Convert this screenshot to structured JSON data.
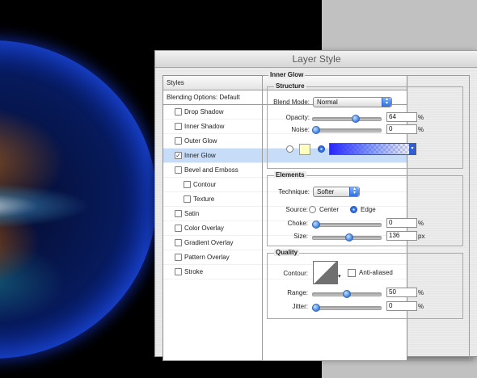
{
  "window": {
    "title": "Layer Style"
  },
  "styles_panel": {
    "header": "Styles",
    "blending": "Blending Options: Default",
    "items": [
      {
        "label": "Drop Shadow",
        "checked": false,
        "level": 0
      },
      {
        "label": "Inner Shadow",
        "checked": false,
        "level": 0
      },
      {
        "label": "Outer Glow",
        "checked": false,
        "level": 0
      },
      {
        "label": "Inner Glow",
        "checked": true,
        "level": 0,
        "selected": true
      },
      {
        "label": "Bevel and Emboss",
        "checked": false,
        "level": 0
      },
      {
        "label": "Contour",
        "checked": false,
        "level": 1
      },
      {
        "label": "Texture",
        "checked": false,
        "level": 1
      },
      {
        "label": "Satin",
        "checked": false,
        "level": 0
      },
      {
        "label": "Color Overlay",
        "checked": false,
        "level": 0
      },
      {
        "label": "Gradient Overlay",
        "checked": false,
        "level": 0
      },
      {
        "label": "Pattern Overlay",
        "checked": false,
        "level": 0
      },
      {
        "label": "Stroke",
        "checked": false,
        "level": 0
      }
    ]
  },
  "inner_glow": {
    "title": "Inner Glow",
    "structure": {
      "title": "Structure",
      "blend_mode_label": "Blend Mode:",
      "blend_mode": "Normal",
      "opacity_label": "Opacity:",
      "opacity": "64",
      "opacity_fraction": 0.64,
      "noise_label": "Noise:",
      "noise": "0",
      "noise_fraction": 0,
      "percent": "%",
      "gradient_start_color": "#2828ff",
      "color_swatch": "#ffffbe",
      "fill_mode": "gradient"
    },
    "elements": {
      "title": "Elements",
      "technique_label": "Technique:",
      "technique": "Softer",
      "source_label": "Source:",
      "source_center": "Center",
      "source_edge": "Edge",
      "source_selected": "edge",
      "choke_label": "Choke:",
      "choke": "0",
      "choke_fraction": 0,
      "size_label": "Size:",
      "size": "136",
      "size_fraction": 0.54,
      "percent": "%",
      "px": "px"
    },
    "quality": {
      "title": "Quality",
      "contour_label": "Contour:",
      "anti_aliased": "Anti-aliased",
      "anti_aliased_checked": false,
      "range_label": "Range:",
      "range": "50",
      "range_fraction": 0.5,
      "jitter_label": "Jitter:",
      "jitter": "0",
      "jitter_fraction": 0,
      "percent": "%"
    }
  },
  "colors": {
    "accent": "#2d6fe6",
    "selection": "#c7dcf6",
    "backdrop": "#c1c1c1"
  }
}
